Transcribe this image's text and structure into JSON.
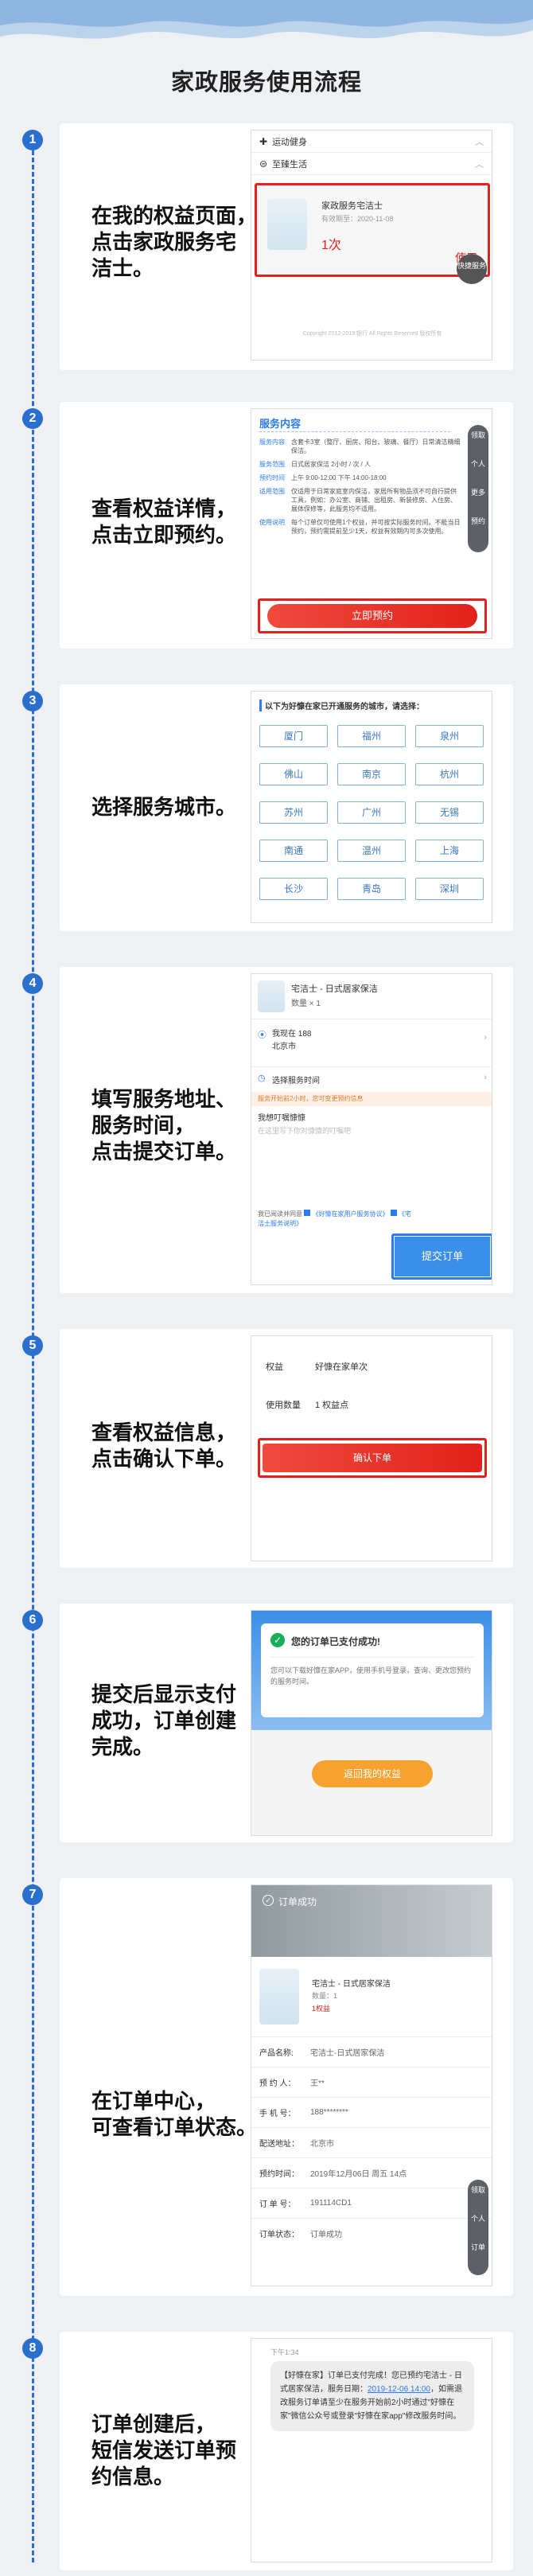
{
  "page": {
    "title": "家政服务使用流程"
  },
  "colors": {
    "accent": "#2b6fce",
    "red": "#e2211c",
    "orange": "#f7a12f",
    "green": "#1aae5b"
  },
  "steps": [
    {
      "num": "1",
      "desc": [
        "在我的权益页面，",
        "点击家政服务宅",
        "洁士。"
      ]
    },
    {
      "num": "2",
      "desc": [
        "查看权益详情，",
        "点击立即预约。"
      ]
    },
    {
      "num": "3",
      "desc": [
        "选择服务城市。"
      ]
    },
    {
      "num": "4",
      "desc": [
        "填写服务地址、",
        "服务时间，",
        "点击提交订单。"
      ]
    },
    {
      "num": "5",
      "desc": [
        "查看权益信息，",
        "点击确认下单。"
      ]
    },
    {
      "num": "6",
      "desc": [
        "提交后显示支付",
        "成功，订单创建",
        "完成。"
      ]
    },
    {
      "num": "7",
      "desc": [
        "在订单中心，",
        "可查看订单状态。"
      ]
    },
    {
      "num": "8",
      "desc": [
        "订单创建后，",
        "短信发送订单预",
        "约信息。"
      ]
    }
  ],
  "s1": {
    "item1": "运动健身",
    "item2": "至臻生活",
    "card_title": "家政服务宅洁士",
    "card_date": "有效期至：2020-11-08",
    "card_count": "1次",
    "use": "使用",
    "float": "快捷服务",
    "footer": "Copyright 2012-2019 银行 All Rights Reserved 版权所有"
  },
  "s2": {
    "header": "服务内容",
    "rows": [
      {
        "k": "服务内容",
        "v": "含套卡3室（整厅、厨房、阳台、玻璃、餐厅）日常清洁精细保洁。"
      },
      {
        "k": "服务范围",
        "v": "日式居家保洁 2小时 / 次 / 人"
      },
      {
        "k": "预约时间",
        "v": "上午 9:00-12:00 下午 14:00-18:00"
      },
      {
        "k": "适用范围",
        "v": "仅适用于日常家庭室内保洁，家居所有物品须不可自行提供工具，例如：办公室、商铺、出租房、新装修房、入住房、展体保修等，此服务均不适用。"
      },
      {
        "k": "使用说明",
        "v": "每个订单仅可使用1个权益，并可按实际服务时间。不能当日预约，预约需提前至少1天，权益有效期内可多次使用。"
      }
    ],
    "button": "立即预约",
    "side": [
      "领取",
      "个人",
      "更多",
      "预约"
    ]
  },
  "s3": {
    "header": "以下为好慷在家已开通服务的城市，请选择：",
    "cities": [
      "厦门",
      "福州",
      "泉州",
      "佛山",
      "南京",
      "杭州",
      "苏州",
      "广州",
      "无锡",
      "南通",
      "温州",
      "上海",
      "长沙",
      "青岛",
      "深圳"
    ]
  },
  "s4": {
    "product": "宅洁士 - 日式居家保洁",
    "qty": "数量 × 1",
    "addr1": "我现在 188",
    "addr2": "北京市",
    "time_label": "选择服务时间",
    "warn": "服务开始前2小时，您可变更预约信息",
    "note_label": "我想叮嘱慷慷",
    "note_ph": "在这里写下你对慷慷的叮嘱吧",
    "agree": "我已阅读并同意",
    "agree_link1": "《好慷在家用户服务协议》",
    "agree_link2": "《宅洁士服务说明》",
    "submit": "提交订单"
  },
  "s5": {
    "k1": "权益",
    "v1": "好慷在家单次",
    "k2": "使用数量",
    "v2": "1 权益点",
    "button": "确认下单"
  },
  "s6": {
    "title": "您的订单已支付成功!",
    "text": "您可以下载好慷在家APP，使用手机号登录，查询、更改您预约的服务时间。",
    "button": "返回我的权益"
  },
  "s7": {
    "banner": "订单成功",
    "product": "宅洁士 - 日式居家保洁",
    "qty": "数量：1",
    "points": "1权益",
    "rows": [
      {
        "k": "产品名称:",
        "v": "宅洁士-日式居家保洁"
      },
      {
        "k": "预 约 人：",
        "v": "王**"
      },
      {
        "k": "手 机 号：",
        "v": "188********"
      },
      {
        "k": "配送地址：",
        "v": "北京市"
      },
      {
        "k": "预约时间：",
        "v": "2019年12月06日 周五 14点"
      },
      {
        "k": "订 单 号：",
        "v": "191114CD1"
      },
      {
        "k": "订单状态：",
        "v": "订单成功"
      }
    ],
    "side": [
      "领取",
      "个人",
      "订单"
    ]
  },
  "s8": {
    "time": "下午1:34",
    "sms1": "【好慷在家】订单已支付完成！您已预约宅洁士 - 日式居家保洁，服务日期：",
    "sms_date": "2019-12-06 14:00",
    "sms2": "，如需退改服务订单请至少在服务开始前2小时通过\"好慷在家\"微信公众号或登录\"好慷在家app\"修改服务时间。"
  }
}
